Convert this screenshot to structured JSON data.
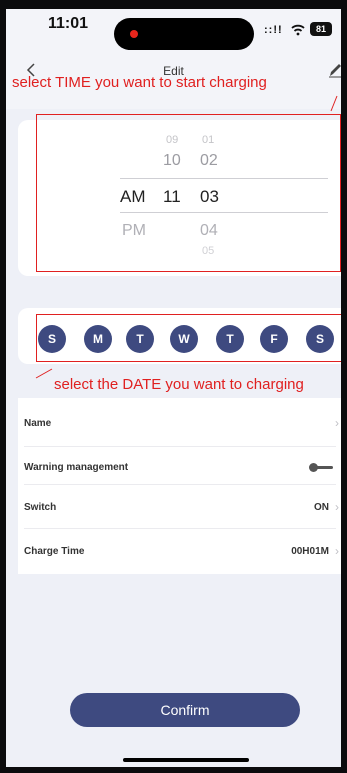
{
  "status_bar": {
    "time": "11:01",
    "signal": "::!!",
    "battery": "81"
  },
  "nav": {
    "title": "Edit"
  },
  "annotations": {
    "top": "select TIME you want to start charging",
    "bottom": "select the DATE you want to charging",
    "color": "#e02020"
  },
  "picker": {
    "ampm_selected": "AM",
    "ampm_other": "PM",
    "hours": [
      "09",
      "10",
      "11"
    ],
    "minutes": [
      "01",
      "02",
      "03",
      "04",
      "05"
    ]
  },
  "days": [
    "S",
    "M",
    "T",
    "W",
    "T",
    "F",
    "S"
  ],
  "settings": {
    "name": {
      "label": "Name",
      "value": ""
    },
    "warning": {
      "label": "Warning management",
      "toggle_on": false
    },
    "switch": {
      "label": "Switch",
      "value": "ON"
    },
    "charge_time": {
      "label": "Charge Time",
      "value": "00H01M"
    }
  },
  "confirm_label": "Confirm",
  "colors": {
    "accent": "#3e4a80",
    "background": "#eef0f7"
  }
}
